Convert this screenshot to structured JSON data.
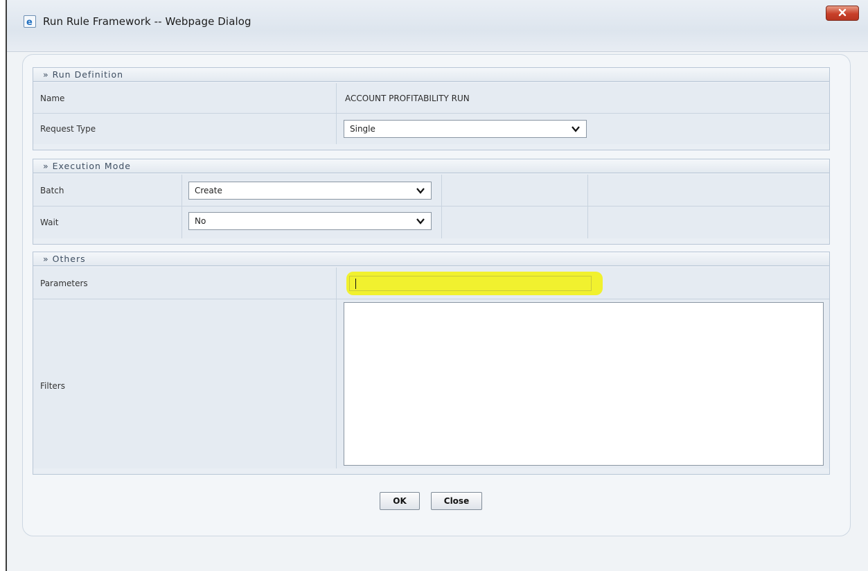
{
  "window": {
    "title": "Run Rule Framework -- Webpage Dialog",
    "icon": "ie-page-icon",
    "close_icon": "close-icon"
  },
  "run_definition": {
    "heading": "» Run Definition",
    "name_label": "Name",
    "name_value": "ACCOUNT PROFITABILITY RUN",
    "request_type_label": "Request Type",
    "request_type_value": "Single"
  },
  "execution_mode": {
    "heading": "» Execution Mode",
    "batch_label": "Batch",
    "batch_value": "Create",
    "wait_label": "Wait",
    "wait_value": "No"
  },
  "others": {
    "heading": "» Others",
    "parameters_label": "Parameters",
    "parameters_value": "",
    "filters_label": "Filters",
    "filters_value": ""
  },
  "buttons": {
    "ok": "OK",
    "close": "Close"
  },
  "colors": {
    "highlight": "#f2f21a",
    "close_button": "#c8402a"
  }
}
